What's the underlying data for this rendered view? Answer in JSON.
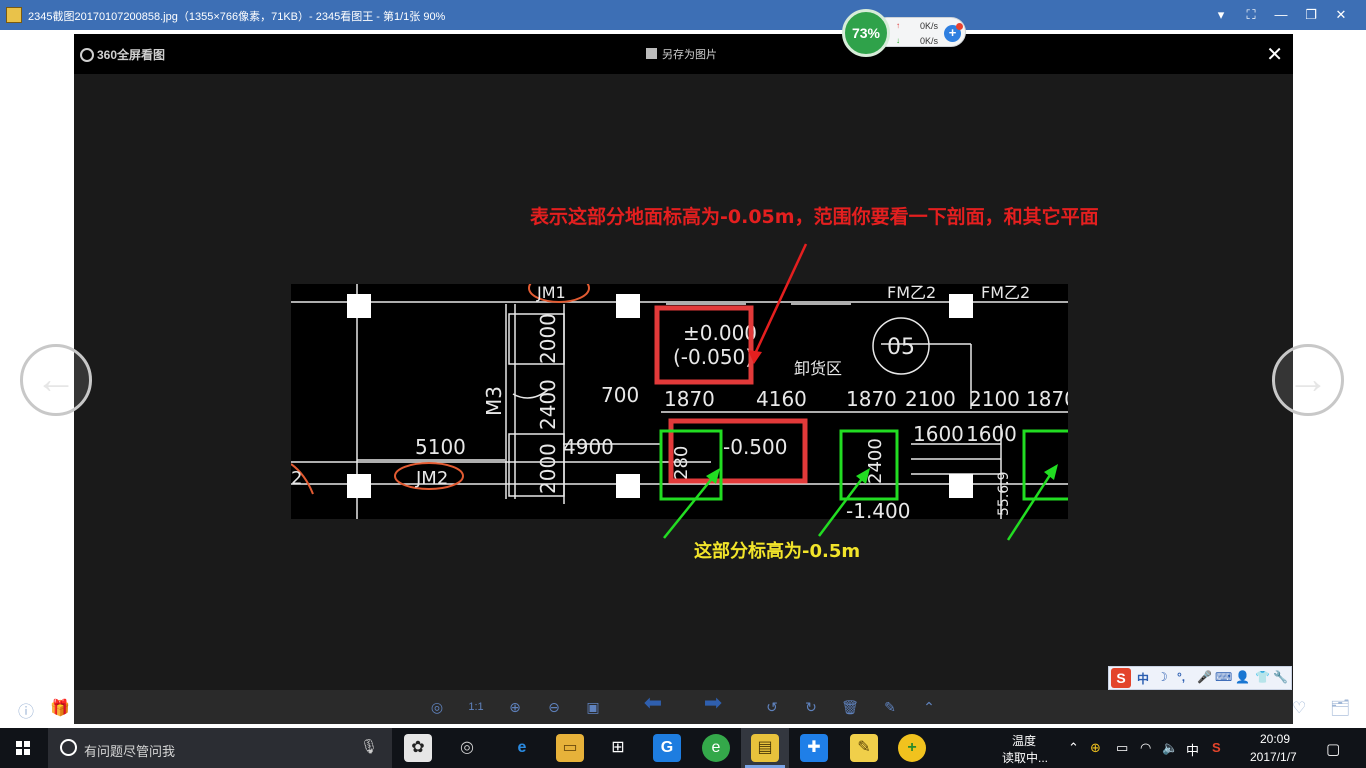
{
  "window": {
    "title": "2345截图20170107200858.jpg（1355×766像素，71KB）- 2345看图王 - 第1/1张 90%",
    "controls": [
      "▾",
      "⛶",
      "—",
      "❐",
      "✕"
    ]
  },
  "net_widget": {
    "percent": "73%",
    "upload": "0K/s",
    "download": "0K/s"
  },
  "viewer": {
    "brand": "360全屏看图",
    "save_as": "另存为图片",
    "close": "✕",
    "annotation_red": "表示这部分地面标高为-0.05m，范围你要看一下剖面，和其它平面",
    "annotation_yellow": "这部分标高为-0.5m",
    "prev": "←",
    "next": "→"
  },
  "drawing": {
    "labels": {
      "elev_top": "±0.000",
      "elev_sub": "(-0.050)",
      "elev_low": "-0.500",
      "area": "卸货区",
      "dim_700": "700",
      "dim_1870a": "1870",
      "dim_4160": "4160",
      "dim_1870b": "1870",
      "dim_2100a": "2100",
      "dim_2100b": "2100",
      "dim_1870c": "1870",
      "dim_5100": "5100",
      "dim_4900": "4900",
      "dim_1600a": "1600",
      "dim_1600b": "1600",
      "dim_1400": "-1.400",
      "v_2000a": "2000",
      "v_2400": "2400",
      "v_2000b": "2000",
      "v_2400b": "2400",
      "v_280": "280",
      "m3": "M3",
      "jm1": "JM1",
      "jm2": "JM2",
      "fm1": "FM乙2",
      "fm2": "FM乙2",
      "circle_num": "05",
      "side_nums": "55.6.9",
      "two": "2"
    }
  },
  "ime": {
    "logo": "S",
    "items": [
      "中",
      "☽",
      "°,",
      "🎤",
      "⌨",
      "👤",
      "👕",
      "🔧"
    ]
  },
  "toolbar": {
    "tools": [
      "◎",
      "1:1",
      "⊕",
      "⊖",
      "▣",
      "⬅",
      "➡",
      "↺",
      "↻",
      "🗑",
      "✎",
      "⌃"
    ]
  },
  "side": {
    "info": "ⓘ",
    "gift": "🎁",
    "heart": "♡",
    "folder": "🗂"
  },
  "taskbar": {
    "search_placeholder": "有问题尽管问我",
    "weather_line1": "温度",
    "weather_line2": "读取中...",
    "ime_lang": "中",
    "time": "20:09",
    "date": "2017/1/7"
  }
}
